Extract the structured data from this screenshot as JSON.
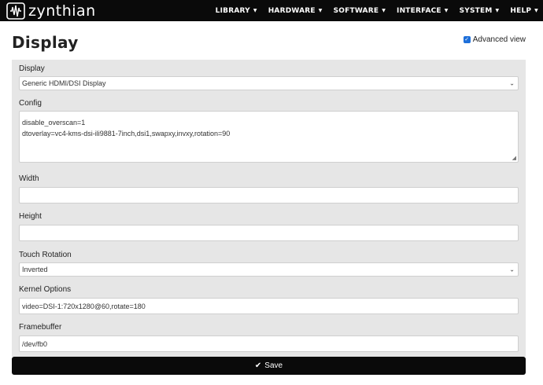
{
  "header": {
    "brand": "zynthian",
    "nav": [
      {
        "label": "LIBRARY"
      },
      {
        "label": "HARDWARE"
      },
      {
        "label": "SOFTWARE"
      },
      {
        "label": "INTERFACE"
      },
      {
        "label": "SYSTEM"
      },
      {
        "label": "HELP"
      }
    ]
  },
  "page": {
    "title": "Display",
    "advanced_view_label": "Advanced view",
    "advanced_view_checked": true
  },
  "form": {
    "display": {
      "label": "Display",
      "selected": "Generic HDMI/DSI Display"
    },
    "config": {
      "label": "Config",
      "lines": [
        "disable_overscan=1",
        "dtoverlay=vc4-kms-dsi-ili9881-7inch,dsi1,swapxy,invxy,rotation=90"
      ]
    },
    "width": {
      "label": "Width",
      "value": ""
    },
    "height": {
      "label": "Height",
      "value": ""
    },
    "touch_rotation": {
      "label": "Touch Rotation",
      "selected": "Inverted"
    },
    "kernel_options": {
      "label": "Kernel Options",
      "value": "video=DSI-1:720x1280@60,rotate=180"
    },
    "framebuffer": {
      "label": "Framebuffer",
      "value": "/dev/fb0"
    }
  },
  "actions": {
    "save_label": "Save"
  }
}
